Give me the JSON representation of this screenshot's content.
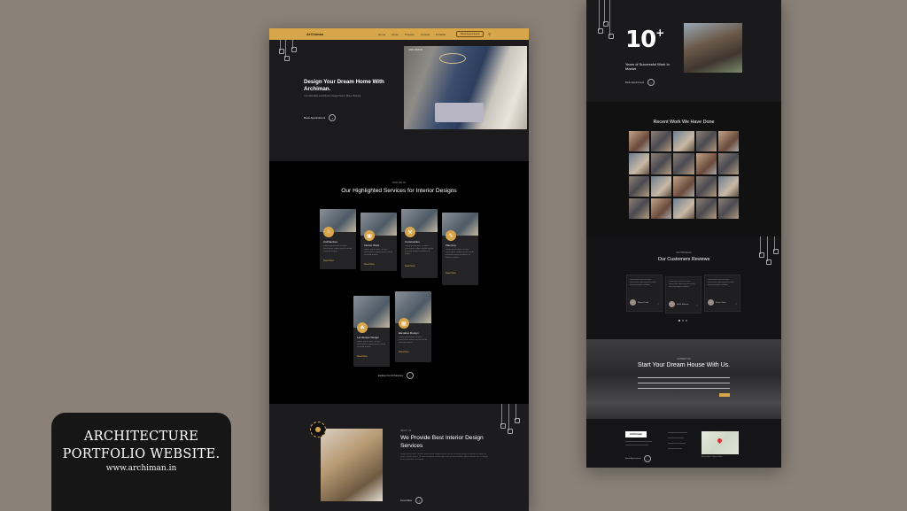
{
  "caption": {
    "line1": "ARCHITECTURE",
    "line2": "PORTFOLIO WEBSITE.",
    "url": "www.archiman.in"
  },
  "nav": {
    "logo": "ArChiman",
    "links": [
      "Home",
      "About",
      "Projects",
      "Contact",
      "Portfolio"
    ],
    "cta": "Book Appointment",
    "search_icon": "search-icon"
  },
  "hero": {
    "title": "Design Your Dream Home With Archiman.",
    "subtitle": "Your Affordable and Effective Design Partner When Planning",
    "button": "Book Appointment",
    "image_caption": "ARCHIMAN"
  },
  "services": {
    "eyebrow": "WHAT WE DO",
    "title": "Our Highlighted Services for Interior Designs",
    "cards": [
      {
        "title": "Architecture",
        "desc": "Lorem ipsum dolor sit amet consectetur adipiscing elit sed do eiusmod tempor",
        "more": "Read More"
      },
      {
        "title": "Interior Work",
        "desc": "Lorem ipsum dolor sit amet consectetur adipiscing elit sed do eiusmod tempor",
        "more": "Read More"
      },
      {
        "title": "Construction",
        "desc": "Lorem ipsum dolor sit amet consectetur adipiscing elit sed do eiusmod tempor incididunt ut labore",
        "more": "Read More"
      },
      {
        "title": "Planning",
        "desc": "Lorem ipsum dolor sit amet consectetur adipiscing elit sed do eiusmod tempor incididunt ut labore et dolore",
        "more": "Read More"
      },
      {
        "title": "Landscape Design",
        "desc": "Lorem ipsum dolor sit amet consectetur adipiscing elit sed do eiusmod tempor",
        "more": "Read More"
      },
      {
        "title": "Elevation Design",
        "desc": "Lorem ipsum dolor sit amet consectetur adipiscing elit sed do eiusmod tempor",
        "more": "Read More"
      }
    ],
    "explore": "Explore Our All Services"
  },
  "provide": {
    "eyebrow": "ABOUT US",
    "title": "We Provide Best Interior Design Services",
    "desc": "Lorem ipsum dolor sit amet consectetur adipiscing elit sed do eiusmod tempor incididunt ut labore et dolore magna aliqua. Ut enim ad minim veniam quis nostrud exercitation ullamco laboris nisi ut aliquip ex ea commodo consequat.",
    "button": "Know More"
  },
  "stats": {
    "number": "10",
    "plus": "+",
    "label": "Years of Successful Work In Market",
    "button": "Book Appointment"
  },
  "recent": {
    "title": "Recent Work We Have Done"
  },
  "reviews": {
    "eyebrow": "TESTIMONIALS",
    "title": "Our Customers Reviews",
    "items": [
      {
        "text": "Lorem ipsum dolor sit amet consectetur adipiscing elit sed do eiusmod tempor incididunt",
        "name": "Manas Patel"
      },
      {
        "text": "Lorem ipsum dolor sit amet consectetur adipiscing elit sed do eiusmod tempor incididunt",
        "name": "Rohit Sharma"
      },
      {
        "text": "Lorem ipsum dolor sit amet consectetur adipiscing elit sed do eiusmod tempor incididunt",
        "name": "Kunal Joshi"
      }
    ]
  },
  "dream": {
    "eyebrow": "CONTACT US",
    "title": "Start Your Dream House With Us."
  },
  "footer": {
    "logo": "ArChiman",
    "button": "Book Appointment",
    "address": "Ahmedabad, Gujarat India"
  },
  "colors": {
    "accent": "#d7a64a",
    "backdrop": "#8a8178",
    "page": "#161618"
  }
}
